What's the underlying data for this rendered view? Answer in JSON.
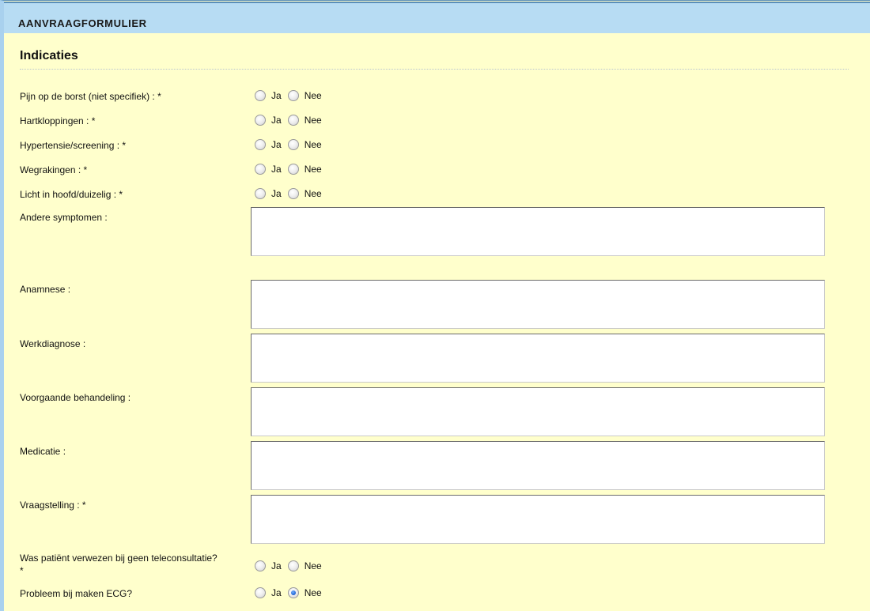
{
  "header": {
    "title": "AANVRAAGFORMULIER"
  },
  "section": {
    "title": "Indicaties"
  },
  "options": {
    "yes": "Ja",
    "no": "Nee"
  },
  "radio_questions": [
    {
      "label": "Pijn op de borst (niet specifiek) : *",
      "selected": ""
    },
    {
      "label": "Hartkloppingen : *",
      "selected": ""
    },
    {
      "label": "Hypertensie/screening : *",
      "selected": ""
    },
    {
      "label": "Wegrakingen : *",
      "selected": ""
    },
    {
      "label": "Licht in hoofd/duizelig : *",
      "selected": ""
    }
  ],
  "text_fields": [
    {
      "label": "Andere symptomen :",
      "value": ""
    },
    {
      "label": "Anamnese :",
      "value": ""
    },
    {
      "label": "Werkdiagnose :",
      "value": ""
    },
    {
      "label": "Voorgaande behandeling :",
      "value": ""
    },
    {
      "label": "Medicatie :",
      "value": ""
    },
    {
      "label": "Vraagstelling : *",
      "value": ""
    }
  ],
  "bottom_questions": [
    {
      "label": "Was patiënt verwezen bij geen teleconsultatie? *",
      "selected": ""
    },
    {
      "label": "Probleem bij maken ECG?",
      "selected": "Nee"
    }
  ]
}
